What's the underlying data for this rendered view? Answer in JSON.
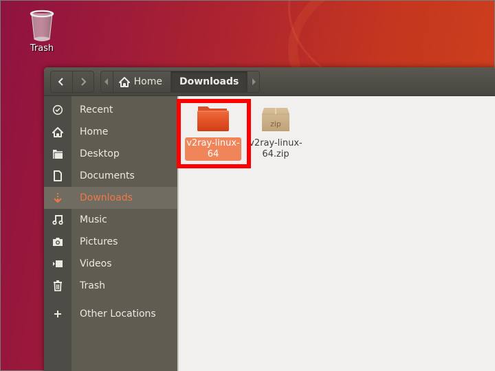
{
  "desktop": {
    "trash_label": "Trash"
  },
  "window": {
    "nav": {
      "back_icon": "chevron-left-icon",
      "forward_icon": "chevron-right-icon"
    },
    "path": {
      "left_arrow_icon": "triangle-left-icon",
      "right_arrow_icon": "triangle-right-icon",
      "crumbs": [
        {
          "label": "Home",
          "icon": "home-icon"
        },
        {
          "label": "Downloads",
          "current": true
        }
      ]
    },
    "sidebar": {
      "items": [
        {
          "label": "Recent",
          "icon": "clock-icon"
        },
        {
          "label": "Home",
          "icon": "home-icon"
        },
        {
          "label": "Desktop",
          "icon": "folder-icon"
        },
        {
          "label": "Documents",
          "icon": "document-icon"
        },
        {
          "label": "Downloads",
          "icon": "download-icon",
          "active": true
        },
        {
          "label": "Music",
          "icon": "music-icon"
        },
        {
          "label": "Pictures",
          "icon": "camera-icon"
        },
        {
          "label": "Videos",
          "icon": "video-icon"
        },
        {
          "label": "Trash",
          "icon": "trash-icon"
        },
        {
          "label": "Other Locations",
          "icon": "plus-icon"
        }
      ]
    },
    "files": [
      {
        "name": "v2ray-linux-64",
        "type": "folder",
        "selected": true
      },
      {
        "name": "v2ray-linux-64.zip",
        "type": "zip",
        "badge": "zip"
      }
    ]
  },
  "colors": {
    "accent": "#f07746",
    "selection": "#f0855a",
    "highlight_box": "#ff0000"
  }
}
